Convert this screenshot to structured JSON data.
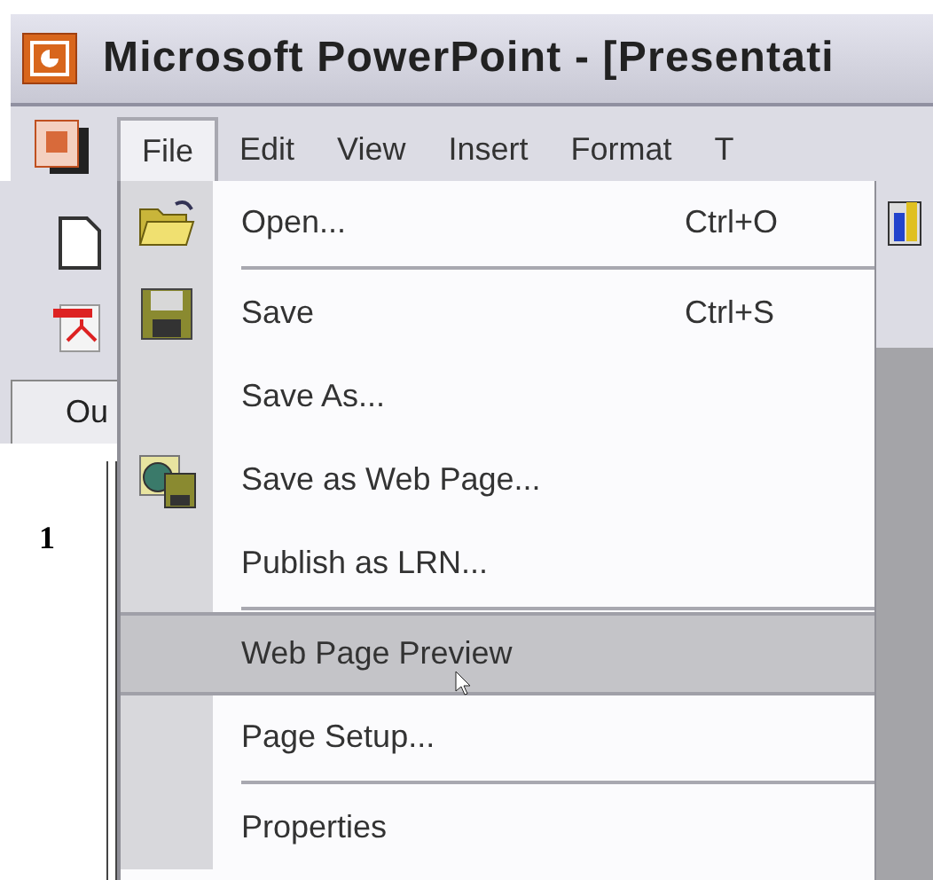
{
  "window": {
    "title": "Microsoft PowerPoint - [Presentati"
  },
  "menu_bar": [
    {
      "label": "File",
      "selected": true
    },
    {
      "label": "Edit",
      "selected": false
    },
    {
      "label": "View",
      "selected": false
    },
    {
      "label": "Insert",
      "selected": false
    },
    {
      "label": "Format",
      "selected": false
    },
    {
      "label": "T",
      "selected": false
    }
  ],
  "file_menu": [
    {
      "kind": "item",
      "label": "Open...",
      "shortcut": "Ctrl+O",
      "selected": false
    },
    {
      "kind": "separator"
    },
    {
      "kind": "item",
      "label": "Save",
      "shortcut": "Ctrl+S",
      "selected": false
    },
    {
      "kind": "item",
      "label": "Save As...",
      "selected": false
    },
    {
      "kind": "item",
      "label": "Save as Web Page...",
      "selected": false
    },
    {
      "kind": "item",
      "label": "Publish as LRN...",
      "selected": false
    },
    {
      "kind": "separator"
    },
    {
      "kind": "item",
      "label": "Web Page Preview",
      "selected": true
    },
    {
      "kind": "item",
      "label": "Page Setup...",
      "selected": false
    },
    {
      "kind": "separator"
    },
    {
      "kind": "item",
      "label": "Properties",
      "selected": false
    }
  ],
  "pane_tab": {
    "label": "Ou"
  },
  "slide_number": "1"
}
